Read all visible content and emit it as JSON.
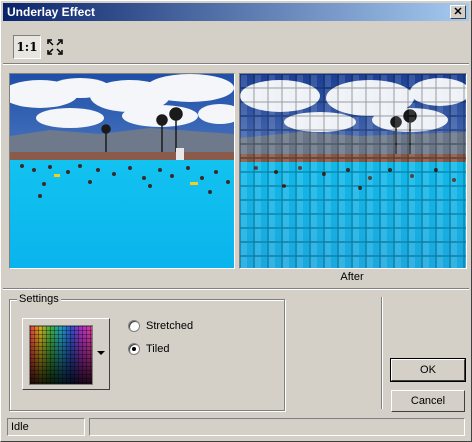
{
  "window": {
    "title": "Underlay Effect",
    "close_glyph": "✕"
  },
  "toolbar": {
    "one_to_one_label": "1:1",
    "fit_icon": "fit-to-window-icon"
  },
  "previews": {
    "after_label": "After"
  },
  "settings": {
    "group_label": "Settings",
    "swatch_icon": "color-palette-swatch",
    "options": [
      {
        "label": "Stretched",
        "checked": false
      },
      {
        "label": "Tiled",
        "checked": true
      }
    ]
  },
  "buttons": {
    "ok": "OK",
    "cancel": "Cancel"
  },
  "status": {
    "text": "Idle",
    "progress": 0
  },
  "colors": {
    "title_start": "#0a246a",
    "title_end": "#a6caf0",
    "face": "#d4d0c8"
  }
}
